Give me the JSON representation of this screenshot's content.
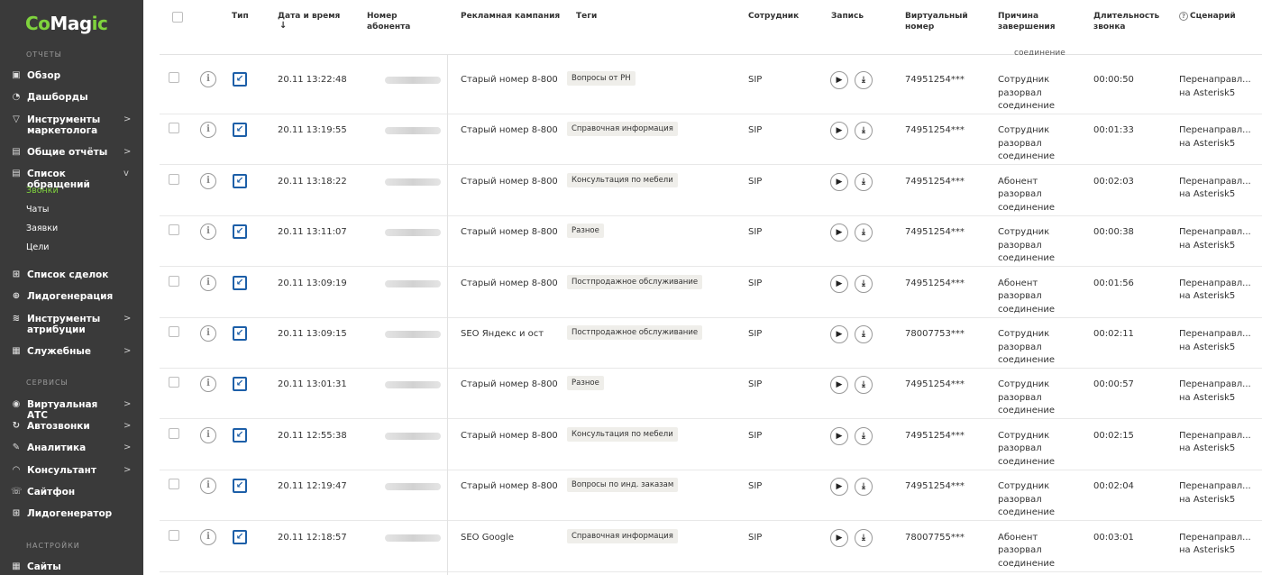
{
  "logo": {
    "part1": "Co",
    "part2": "Mag",
    "part3": "ic"
  },
  "sidebar": {
    "section_reports": "ОТЧЕТЫ",
    "section_services": "СЕРВИСЫ",
    "section_settings": "НАСТРОЙКИ",
    "reports": [
      {
        "label": "Обзор",
        "icon": "overview-icon",
        "glyph": "▣",
        "arrow": ""
      },
      {
        "label": "Дашборды",
        "icon": "dashboard-icon",
        "glyph": "◔",
        "arrow": ""
      },
      {
        "label": "Инструменты маркетолога",
        "icon": "filter-icon",
        "glyph": "▽",
        "arrow": ">"
      },
      {
        "label": "Общие отчёты",
        "icon": "reports-icon",
        "glyph": "▤",
        "arrow": ">"
      },
      {
        "label": "Список обращений",
        "icon": "list-icon",
        "glyph": "▤",
        "arrow": "v"
      }
    ],
    "sub_items": [
      {
        "label": "Звонки",
        "active": true
      },
      {
        "label": "Чаты",
        "active": false
      },
      {
        "label": "Заявки",
        "active": false
      },
      {
        "label": "Цели",
        "active": false
      }
    ],
    "reports2": [
      {
        "label": "Список сделок",
        "icon": "cart-icon",
        "glyph": "⊞",
        "arrow": ""
      },
      {
        "label": "Лидогенерация",
        "icon": "leadgen-icon",
        "glyph": "⊕",
        "arrow": ""
      },
      {
        "label": "Инструменты атрибуции",
        "icon": "attribution-icon",
        "glyph": "≋",
        "arrow": ">"
      },
      {
        "label": "Служебные",
        "icon": "service-icon",
        "glyph": "▦",
        "arrow": ">"
      }
    ],
    "services": [
      {
        "label": "Виртуальная АТС",
        "icon": "pbx-icon",
        "glyph": "◉",
        "arrow": ">"
      },
      {
        "label": "Автозвонки",
        "icon": "autocall-icon",
        "glyph": "↻",
        "arrow": ">"
      },
      {
        "label": "Аналитика",
        "icon": "analytics-icon",
        "glyph": "✎",
        "arrow": ">"
      },
      {
        "label": "Консультант",
        "icon": "consultant-icon",
        "glyph": "◠",
        "arrow": ">"
      },
      {
        "label": "Сайтфон",
        "icon": "sitephone-icon",
        "glyph": "☏",
        "arrow": ""
      },
      {
        "label": "Лидогенератор",
        "icon": "leadgenerator-icon",
        "glyph": "⊞",
        "arrow": ""
      }
    ],
    "settings": [
      {
        "label": "Сайты",
        "icon": "sites-icon",
        "glyph": "▦",
        "arrow": ""
      }
    ]
  },
  "table": {
    "headers": {
      "type": "Тип",
      "datetime": "Дата и время",
      "sort_arrow": "↓",
      "subscriber": "Номер абонента",
      "campaign": "Рекламная кампания",
      "tags": "Теги",
      "employee": "Сотрудник",
      "record": "Запись",
      "virtual_number": "Виртуальный номер",
      "reason": "Причина завершения",
      "duration": "Длительность звонка",
      "scenario": "Сценарий",
      "scenario_icon_glyph": "?"
    },
    "header_cut_text": "соединение",
    "play_glyph": "▶",
    "download_glyph": "⤓",
    "info_glyph": "i",
    "type_glyph": "↙",
    "rows": [
      {
        "datetime": "20.11 13:22:48",
        "campaign": "Старый номер 8-800",
        "tag": "Вопросы от РН",
        "employee": "SIP",
        "virtual_number": "74951254***",
        "reason_1": "Сотрудник",
        "reason_2": "разорвал",
        "reason_3": "соединение",
        "duration": "00:00:50",
        "scenario_1": "Перенаправл...",
        "scenario_2": "на Asterisk5"
      },
      {
        "datetime": "20.11 13:19:55",
        "campaign": "Старый номер 8-800",
        "tag": "Справочная информация",
        "employee": "SIP",
        "virtual_number": "74951254***",
        "reason_1": "Сотрудник",
        "reason_2": "разорвал",
        "reason_3": "соединение",
        "duration": "00:01:33",
        "scenario_1": "Перенаправл...",
        "scenario_2": "на Asterisk5"
      },
      {
        "datetime": "20.11 13:18:22",
        "campaign": "Старый номер 8-800",
        "tag": "Консультация по мебели",
        "employee": "SIP",
        "virtual_number": "74951254***",
        "reason_1": "Абонент",
        "reason_2": "разорвал",
        "reason_3": "соединение",
        "duration": "00:02:03",
        "scenario_1": "Перенаправл...",
        "scenario_2": "на Asterisk5"
      },
      {
        "datetime": "20.11 13:11:07",
        "campaign": "Старый номер 8-800",
        "tag": "Разное",
        "employee": "SIP",
        "virtual_number": "74951254***",
        "reason_1": "Сотрудник",
        "reason_2": "разорвал",
        "reason_3": "соединение",
        "duration": "00:00:38",
        "scenario_1": "Перенаправл...",
        "scenario_2": "на Asterisk5"
      },
      {
        "datetime": "20.11 13:09:19",
        "campaign": "Старый номер 8-800",
        "tag": "Постпродажное обслуживание",
        "employee": "SIP",
        "virtual_number": "74951254***",
        "reason_1": "Абонент",
        "reason_2": "разорвал",
        "reason_3": "соединение",
        "duration": "00:01:56",
        "scenario_1": "Перенаправл...",
        "scenario_2": "на Asterisk5"
      },
      {
        "datetime": "20.11 13:09:15",
        "campaign": "SEO Яндекс и ост",
        "tag": "Постпродажное обслуживание",
        "employee": "SIP",
        "virtual_number": "78007753***",
        "reason_1": "Сотрудник",
        "reason_2": "разорвал",
        "reason_3": "соединение",
        "duration": "00:02:11",
        "scenario_1": "Перенаправл...",
        "scenario_2": "на Asterisk5"
      },
      {
        "datetime": "20.11 13:01:31",
        "campaign": "Старый номер 8-800",
        "tag": "Разное",
        "employee": "SIP",
        "virtual_number": "74951254***",
        "reason_1": "Сотрудник",
        "reason_2": "разорвал",
        "reason_3": "соединение",
        "duration": "00:00:57",
        "scenario_1": "Перенаправл...",
        "scenario_2": "на Asterisk5"
      },
      {
        "datetime": "20.11 12:55:38",
        "campaign": "Старый номер 8-800",
        "tag": "Консультация по мебели",
        "employee": "SIP",
        "virtual_number": "74951254***",
        "reason_1": "Сотрудник",
        "reason_2": "разорвал",
        "reason_3": "соединение",
        "duration": "00:02:15",
        "scenario_1": "Перенаправл...",
        "scenario_2": "на Asterisk5"
      },
      {
        "datetime": "20.11 12:19:47",
        "campaign": "Старый номер 8-800",
        "tag": "Вопросы по инд. заказам",
        "employee": "SIP",
        "virtual_number": "74951254***",
        "reason_1": "Сотрудник",
        "reason_2": "разорвал",
        "reason_3": "соединение",
        "duration": "00:02:04",
        "scenario_1": "Перенаправл...",
        "scenario_2": "на Asterisk5"
      },
      {
        "datetime": "20.11 12:18:57",
        "campaign": "SEO Google",
        "tag": "Справочная информация",
        "employee": "SIP",
        "virtual_number": "78007755***",
        "reason_1": "Абонент",
        "reason_2": "разорвал",
        "reason_3": "соединение",
        "duration": "00:03:01",
        "scenario_1": "Перенаправл...",
        "scenario_2": "на Asterisk5"
      }
    ]
  },
  "colors": {
    "sidebar_bg": "#3a3a3a",
    "accent": "#7fd33d",
    "type_icon": "#1d5fa8"
  }
}
